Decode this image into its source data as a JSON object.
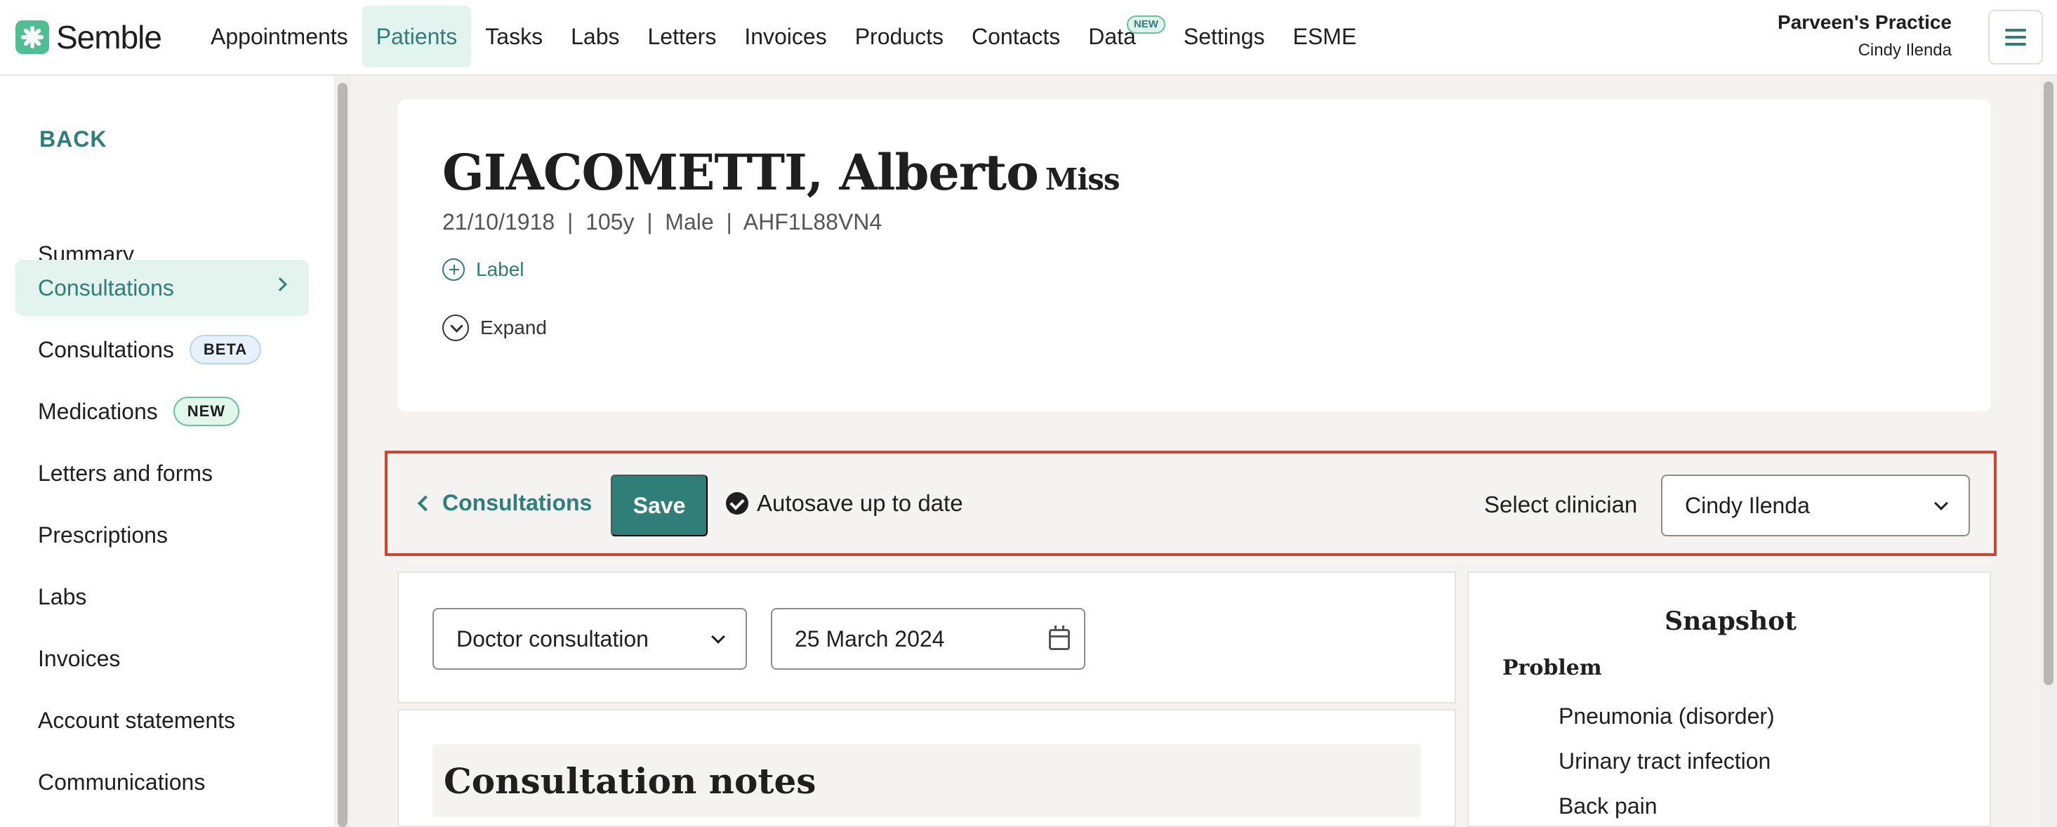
{
  "brand": {
    "name": "Semble",
    "accent": "#2f7e78",
    "logo_color": "#4fbf93",
    "highlight_border": "#d0432f"
  },
  "nav": {
    "items": [
      {
        "label": "Appointments"
      },
      {
        "label": "Patients",
        "active": true
      },
      {
        "label": "Tasks"
      },
      {
        "label": "Labs"
      },
      {
        "label": "Letters"
      },
      {
        "label": "Invoices"
      },
      {
        "label": "Products"
      },
      {
        "label": "Contacts"
      },
      {
        "label": "Data",
        "badge": "NEW"
      },
      {
        "label": "Settings"
      },
      {
        "label": "ESME"
      }
    ],
    "practice_name": "Parveen's Practice",
    "user_name": "Cindy Ilenda",
    "menu_icon": "hamburger-icon"
  },
  "sidebar": {
    "back_label": "BACK",
    "items": [
      {
        "label": "Summary"
      },
      {
        "label": "Consultations",
        "active": true
      },
      {
        "label": "Consultations",
        "badge": "BETA"
      },
      {
        "label": "Medications",
        "badge": "NEW"
      },
      {
        "label": "Letters and forms"
      },
      {
        "label": "Prescriptions"
      },
      {
        "label": "Labs"
      },
      {
        "label": "Invoices"
      },
      {
        "label": "Account statements"
      },
      {
        "label": "Communications"
      }
    ]
  },
  "patient": {
    "name": "GIACOMETTI, Alberto",
    "title": "Miss",
    "meta": "21/10/1918  |  105y  |  Male  |  AHF1L88VN4",
    "label_link": "Label",
    "expand_label": "Expand"
  },
  "toolbar": {
    "back_label": "Consultations",
    "save_label": "Save",
    "autosave_status": "Autosave up to date",
    "clinician_label": "Select clinician",
    "clinician_value": "Cindy Ilenda"
  },
  "consultation": {
    "type_value": "Doctor consultation",
    "date_value": "25 March 2024",
    "notes_heading": "Consultation notes"
  },
  "snapshot": {
    "title": "Snapshot",
    "section": "Problem",
    "problems": [
      "Pneumonia (disorder)",
      "Urinary tract infection",
      "Back pain"
    ]
  }
}
